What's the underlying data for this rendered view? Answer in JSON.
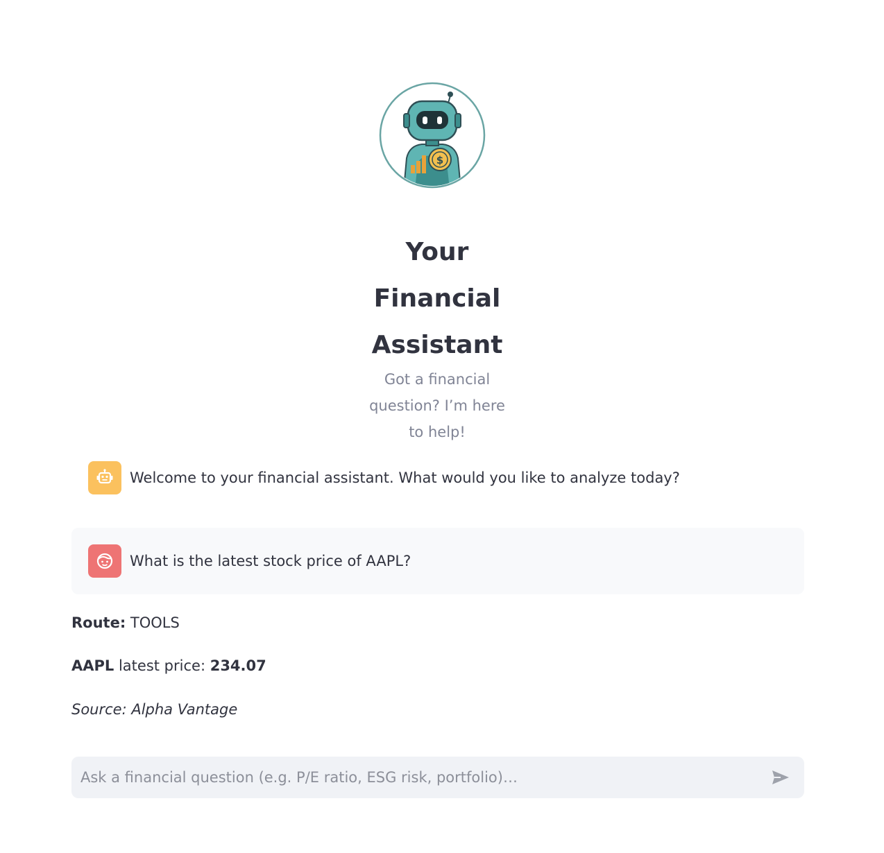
{
  "header": {
    "logo_icon": "robot-finance-logo-icon",
    "title_lines": [
      "Your",
      "Financial",
      "Assistant"
    ],
    "subtitle_lines": [
      "Got a financial",
      "question? I’m here",
      "to help!"
    ]
  },
  "messages": [
    {
      "role": "assistant",
      "avatar_icon": "robot-icon",
      "text": "Welcome to your financial assistant. What would you like to analyze today?"
    },
    {
      "role": "user",
      "avatar_icon": "user-face-icon",
      "text": "What is the latest stock price of AAPL?"
    }
  ],
  "response": {
    "route_label": "Route:",
    "route_value": "TOOLS",
    "ticker": "AAPL",
    "price_label": "latest price:",
    "price_value": "234.07",
    "source": "Source: Alpha Vantage"
  },
  "input": {
    "placeholder": "Ask a financial question (e.g. P/E ratio, ESG risk, portfolio)…",
    "send_icon": "send-icon"
  },
  "colors": {
    "assistant_avatar": "#fbc15e",
    "user_avatar": "#ee7474",
    "user_bubble": "#f8f9fb",
    "input_bg": "#f0f2f6",
    "logo_ring": "#6aa5a4",
    "robot_teal": "#5fb5b3"
  }
}
